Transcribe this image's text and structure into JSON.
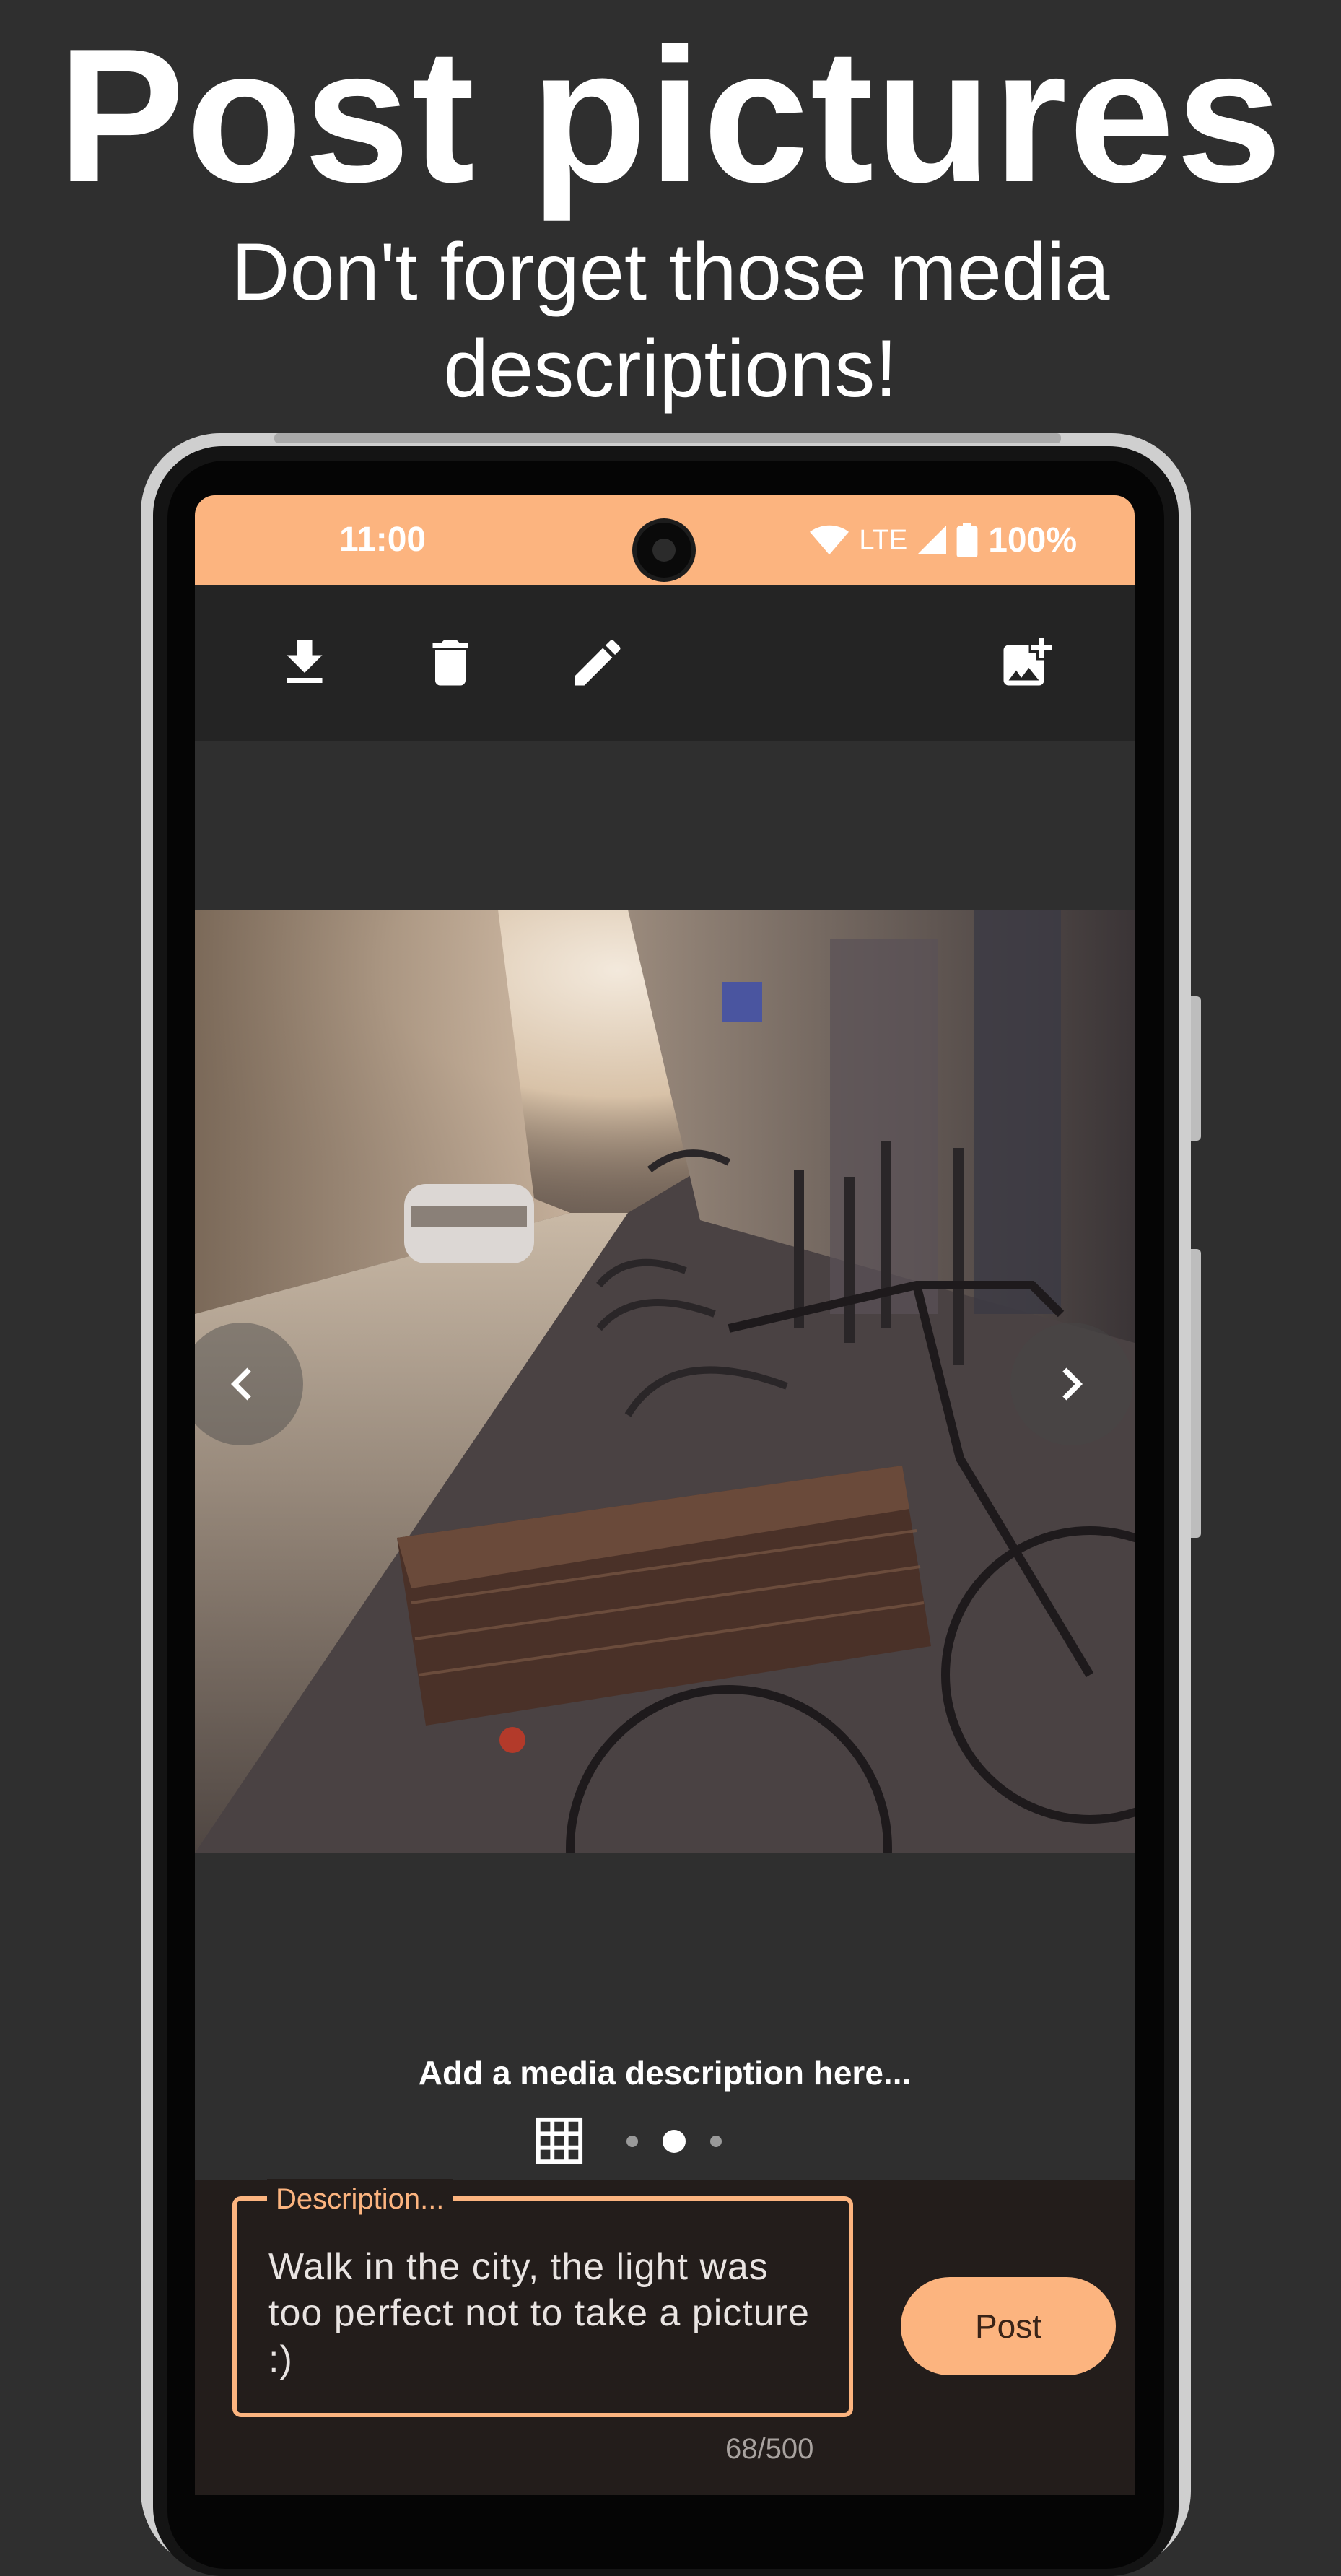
{
  "promo": {
    "headline": "Post pictures",
    "subline": "Don't forget those media descriptions!"
  },
  "statusbar": {
    "time": "11:00",
    "network": "LTE",
    "battery": "100%",
    "color": "#fcb47f"
  },
  "toolbar": {
    "icons": [
      "download-icon",
      "delete-icon",
      "edit-icon",
      "add-image-icon"
    ]
  },
  "media": {
    "caption": "Add a media description here...",
    "pager": {
      "count": 3,
      "active": 2
    }
  },
  "compose": {
    "label": "Description...",
    "text": "Walk in the city, the light was too perfect not to take a picture :)",
    "post_label": "Post",
    "counter": "68/500"
  },
  "colors": {
    "accent": "#fcb47f",
    "background": "#2f2f2f",
    "toolbar": "#242424",
    "compose": "#231d1b"
  }
}
